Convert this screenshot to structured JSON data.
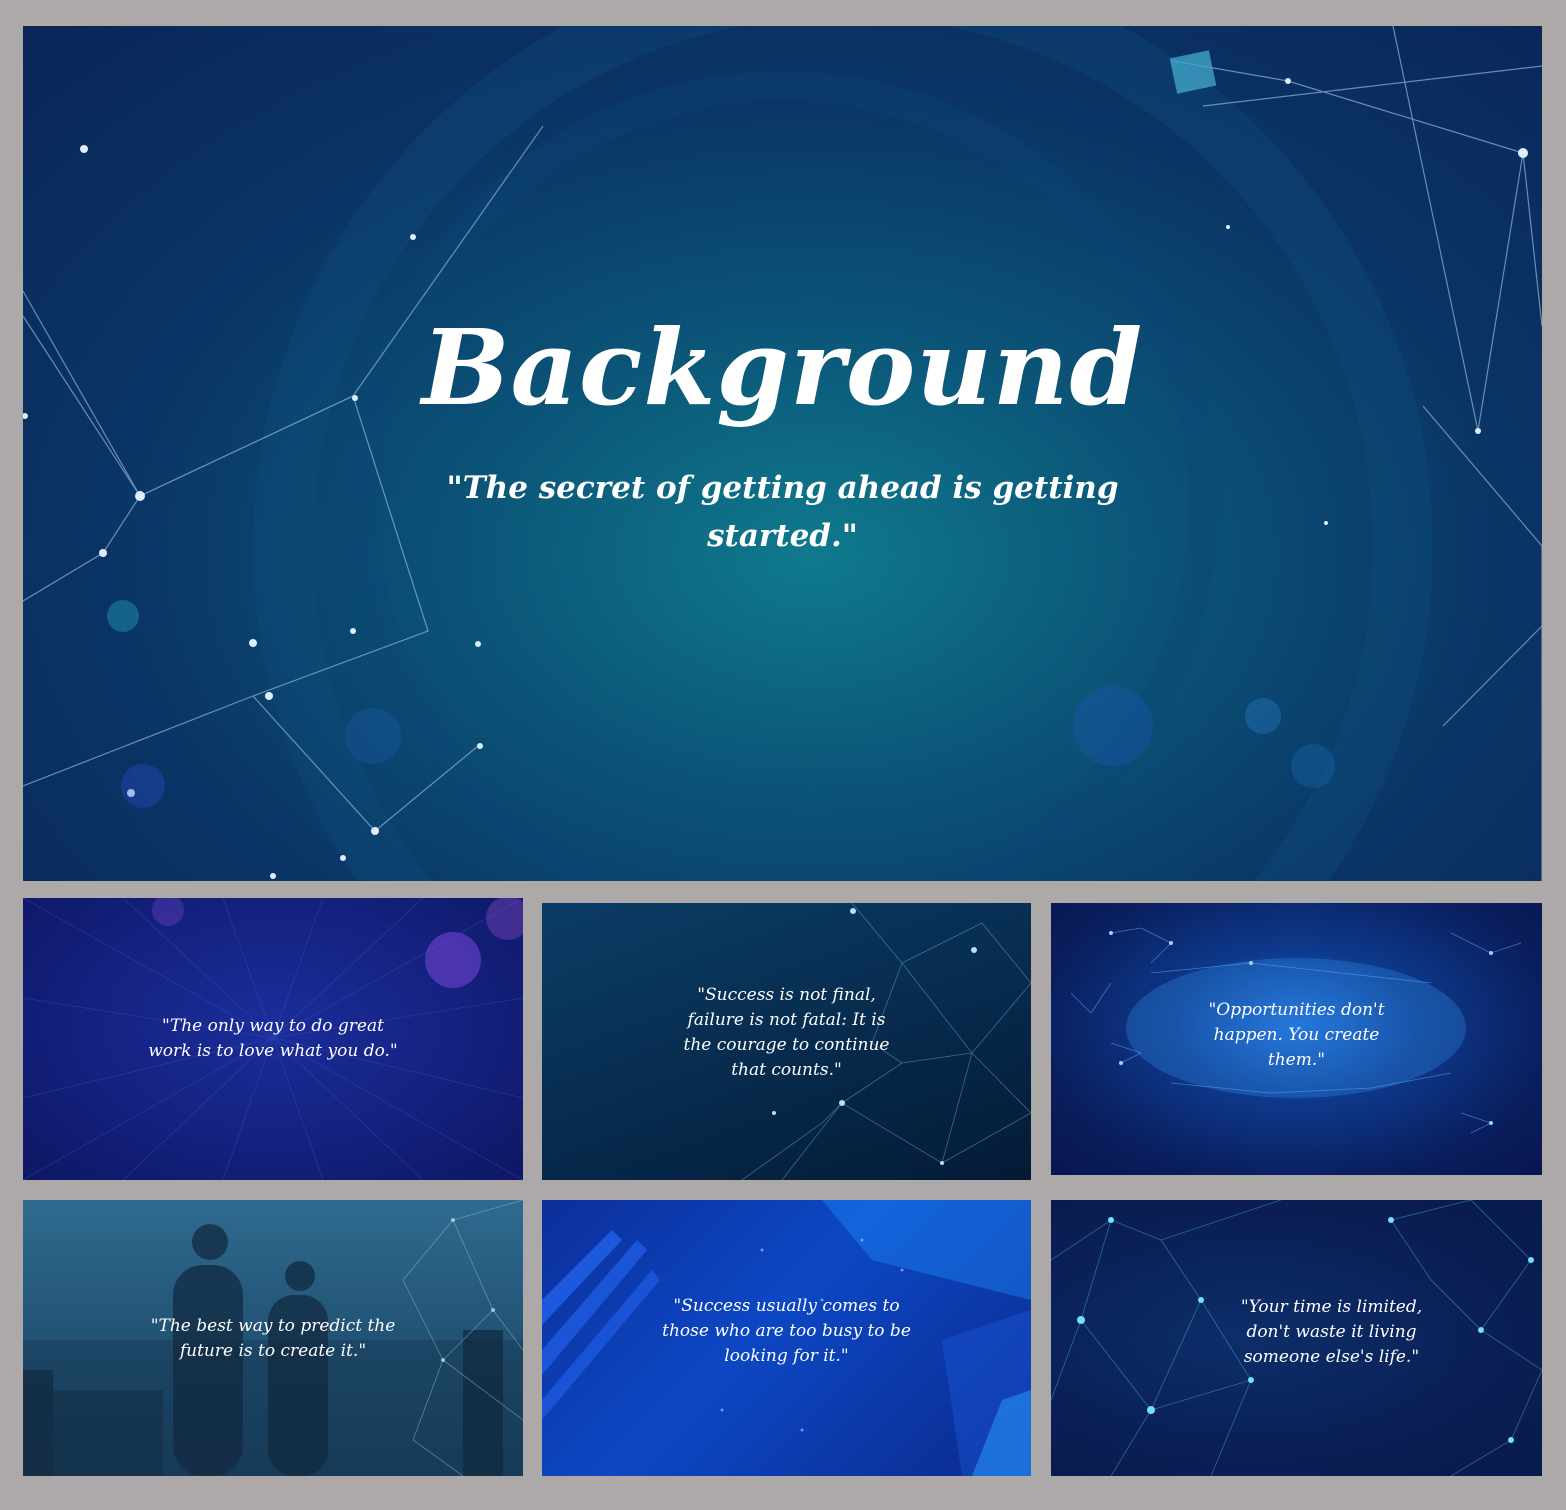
{
  "main_slide": {
    "title": "Background",
    "quote": "\"The secret of getting ahead is getting started.\""
  },
  "thumbnails": [
    {
      "quote": "\"The only way to do great work is to love what you do.\""
    },
    {
      "quote": "\"Success is not final, failure is not fatal: It is the courage to continue that counts.\""
    },
    {
      "quote": "\"Opportunities don't happen. You create them.\""
    },
    {
      "quote": "\"The best way to predict the future is to create it.\""
    },
    {
      "quote": "\"Success usually comes to those who are too busy to be looking for it.\""
    },
    {
      "quote": "\"Your time is limited, don't waste it living someone else's life.\""
    }
  ]
}
